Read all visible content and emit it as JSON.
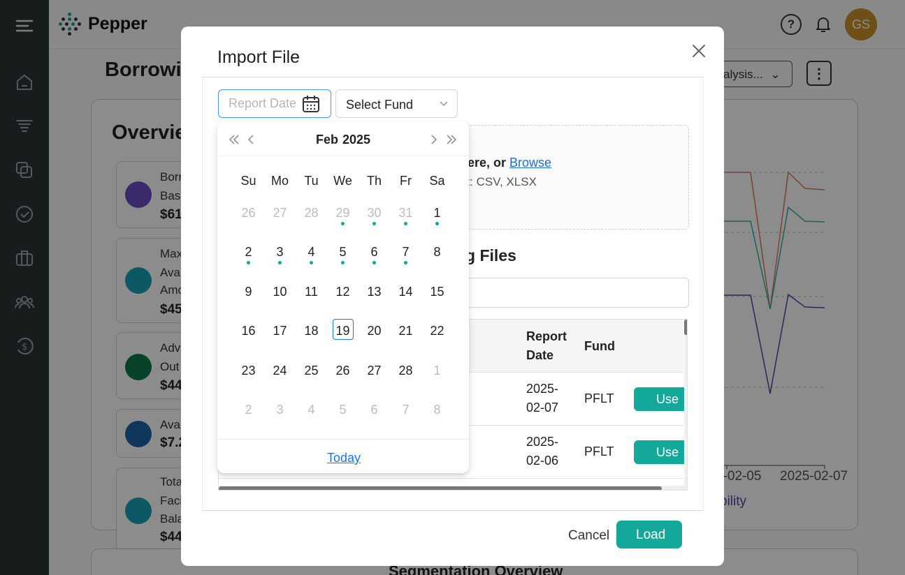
{
  "app": {
    "name": "Pepper",
    "user_initials": "GS",
    "page_title": "Borrowin",
    "analysis_select": "alysis...",
    "overview_title": "Overvie",
    "segmentation_title": "Segmentation Overview",
    "metrics": [
      {
        "line1": "Borr",
        "line2": "Base",
        "line3": "",
        "value": "$61",
        "color": "#6b4bc4"
      },
      {
        "line1": "Max",
        "line2": "Ava",
        "line3": "Amo",
        "value": "$45",
        "color": "#17a2b8"
      },
      {
        "line1": "Adv",
        "line2": "Out",
        "line3": "",
        "value": "$44",
        "color": "#0e7a4b"
      },
      {
        "line1": "Ava",
        "line2": "",
        "line3": "",
        "value": "$7.2",
        "color": "#1f63a8"
      },
      {
        "line1": "Tota",
        "line2": "Faci",
        "line3": "Bala",
        "value": "$44",
        "color": "#17a2b8"
      }
    ],
    "chart": {
      "x_ticks": [
        "5-02-05",
        "2025-02-07"
      ],
      "legend": "bility",
      "colors": {
        "orange": "#e07a5f",
        "teal": "#2bb5a5",
        "purple": "#5b3fa8"
      }
    }
  },
  "modal": {
    "title": "Import File",
    "report_date_placeholder": "Report Date",
    "fund_select": "Select Fund",
    "dropzone_main": "here, or ",
    "dropzone_browse": "Browse",
    "dropzone_sub": "at: CSV, XLSX",
    "existing_title": "ng Files",
    "table": {
      "headers": {
        "report_date_1": "Report",
        "report_date_2": "Date",
        "fund": "Fund"
      },
      "rows": [
        {
          "date_1": "2025-",
          "date_2": "02-07",
          "fund": "PFLT",
          "action": "Use"
        },
        {
          "date_1": "2025-",
          "date_2": "02-06",
          "fund": "PFLT",
          "action": "Use"
        }
      ]
    },
    "cancel": "Cancel",
    "load": "Load"
  },
  "calendar": {
    "month": "Feb",
    "year": "2025",
    "weekdays": [
      "Su",
      "Mo",
      "Tu",
      "We",
      "Th",
      "Fr",
      "Sa"
    ],
    "today_label": "Today",
    "accent": "#14a89a",
    "weeks": [
      [
        {
          "d": "26",
          "muted": true,
          "dot": false
        },
        {
          "d": "27",
          "muted": true,
          "dot": false
        },
        {
          "d": "28",
          "muted": true,
          "dot": false
        },
        {
          "d": "29",
          "muted": true,
          "dot": true
        },
        {
          "d": "30",
          "muted": true,
          "dot": true
        },
        {
          "d": "31",
          "muted": true,
          "dot": true
        },
        {
          "d": "1",
          "muted": false,
          "dot": true
        }
      ],
      [
        {
          "d": "2",
          "muted": false,
          "dot": true
        },
        {
          "d": "3",
          "muted": false,
          "dot": true
        },
        {
          "d": "4",
          "muted": false,
          "dot": true
        },
        {
          "d": "5",
          "muted": false,
          "dot": true
        },
        {
          "d": "6",
          "muted": false,
          "dot": true
        },
        {
          "d": "7",
          "muted": false,
          "dot": true
        },
        {
          "d": "8",
          "muted": false,
          "dot": false
        }
      ],
      [
        {
          "d": "9",
          "muted": false,
          "dot": false
        },
        {
          "d": "10",
          "muted": false,
          "dot": false
        },
        {
          "d": "11",
          "muted": false,
          "dot": false
        },
        {
          "d": "12",
          "muted": false,
          "dot": false
        },
        {
          "d": "13",
          "muted": false,
          "dot": false
        },
        {
          "d": "14",
          "muted": false,
          "dot": false
        },
        {
          "d": "15",
          "muted": false,
          "dot": false
        }
      ],
      [
        {
          "d": "16",
          "muted": false,
          "dot": false
        },
        {
          "d": "17",
          "muted": false,
          "dot": false
        },
        {
          "d": "18",
          "muted": false,
          "dot": false
        },
        {
          "d": "19",
          "muted": false,
          "dot": false,
          "today": true
        },
        {
          "d": "20",
          "muted": false,
          "dot": false
        },
        {
          "d": "21",
          "muted": false,
          "dot": false
        },
        {
          "d": "22",
          "muted": false,
          "dot": false
        }
      ],
      [
        {
          "d": "23",
          "muted": false,
          "dot": false
        },
        {
          "d": "24",
          "muted": false,
          "dot": false
        },
        {
          "d": "25",
          "muted": false,
          "dot": false
        },
        {
          "d": "26",
          "muted": false,
          "dot": false
        },
        {
          "d": "27",
          "muted": false,
          "dot": false
        },
        {
          "d": "28",
          "muted": false,
          "dot": false
        },
        {
          "d": "1",
          "muted": true,
          "dot": false
        }
      ],
      [
        {
          "d": "2",
          "muted": true,
          "dot": false
        },
        {
          "d": "3",
          "muted": true,
          "dot": false
        },
        {
          "d": "4",
          "muted": true,
          "dot": false
        },
        {
          "d": "5",
          "muted": true,
          "dot": false
        },
        {
          "d": "6",
          "muted": true,
          "dot": false
        },
        {
          "d": "7",
          "muted": true,
          "dot": false
        },
        {
          "d": "8",
          "muted": true,
          "dot": false
        }
      ]
    ]
  }
}
